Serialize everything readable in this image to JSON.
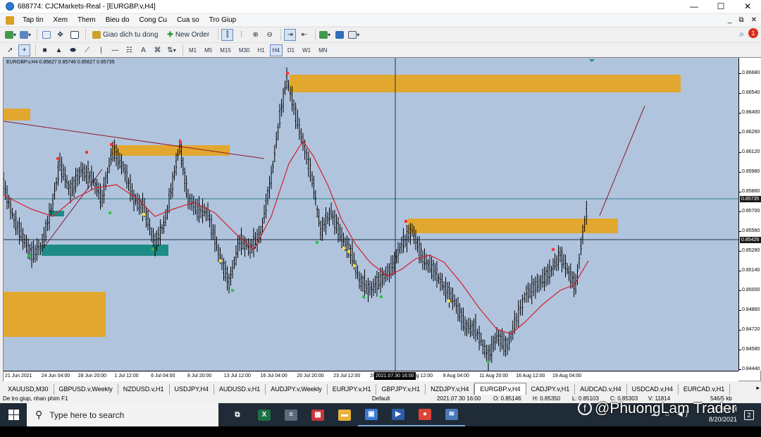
{
  "window": {
    "title": "688774: CJCMarkets-Real - [EURGBP.v,H4]",
    "controls": [
      "—",
      "☐",
      "✕"
    ]
  },
  "menu": {
    "items": [
      "Tap tin",
      "Xem",
      "Them",
      "Bieu do",
      "Cong Cu",
      "Cua so",
      "Tro Giup"
    ],
    "mdi_controls": [
      "_",
      "⧉",
      "✕"
    ]
  },
  "toolbar": {
    "autotrade_label": "Giao dich tu dong",
    "new_order_label": "New Order",
    "timeframes": [
      "M1",
      "M5",
      "M15",
      "M30",
      "H1",
      "H4",
      "D1",
      "W1",
      "MN"
    ],
    "active_timeframe": "H4",
    "notification_count": "1"
  },
  "chart": {
    "header": "EURGBP.v,H4  0.85627 0.85746 0.85627 0.85735",
    "price_labels": [
      "0.86680",
      "0.86540",
      "0.86400",
      "0.86260",
      "0.86120",
      "0.85980",
      "0.85860",
      "0.85700",
      "0.85560",
      "0.85280",
      "0.85140",
      "0.85000",
      "0.84860",
      "0.84720",
      "0.84580",
      "0.84440"
    ],
    "current_price": "0.85735",
    "crosshair_price": "0.85426",
    "time_labels": [
      "21 Jun 2021",
      "24 Jun 04:00",
      "28 Jun 20:00",
      "1 Jul 12:00",
      "6 Jul 04:00",
      "8 Jul 20:00",
      "13 Jul 12:00",
      "16 Jul 04:00",
      "20 Jul 20:00",
      "23 Jul 12:00",
      "28 Ju",
      "4 Aug 12:00",
      "9 Aug 04:00",
      "11 Aug 20:00",
      "16 Aug 12:00",
      "19 Aug 04:00"
    ],
    "crosshair_time": "2021.07.30 16:00",
    "colors": {
      "background": "#b1c4de",
      "candles": "#000000",
      "moving_average": "#d0202a",
      "supply_zone": "#e2a72e",
      "demand_zone": "#1e8c86"
    }
  },
  "tabs": {
    "items": [
      "XAUUSD,M30",
      "GBPUSD.v,Weekly",
      "NZDUSD.v,H1",
      "USDJPY,H4",
      "AUDUSD.v,H1",
      "AUDJPY.v,Weekly",
      "EURJPY.v,H1",
      "GBPJPY.v,H1",
      "NZDJPY.v,H4",
      "EURGBP.v,H4",
      "CADJPY.v,H1",
      "AUDCAD.v,H4",
      "USDCAD.v,H4",
      "EURCAD.v,H1"
    ],
    "active": "EURGBP.v,H4"
  },
  "status": {
    "help": "De tro giup, nhan phim F1",
    "profile": "Default",
    "datetime": "2021.07.30 16:00",
    "open": "O: 0.85146",
    "high": "H: 0.85350",
    "low": "L: 0.85103",
    "close": "C: 0.85303",
    "volume": "V: 11814",
    "traffic": "546/5 kb"
  },
  "taskbar": {
    "search_placeholder": "Type here to search",
    "time": "8:15 PM",
    "date": "8/20/2021",
    "notifications": "2",
    "apps": [
      {
        "name": "task-view",
        "color": "#1f2b36",
        "glyph": "⧉"
      },
      {
        "name": "excel",
        "color": "#1d7044",
        "glyph": "X"
      },
      {
        "name": "calculator",
        "color": "#5a6b7c",
        "glyph": "="
      },
      {
        "name": "app-grid",
        "color": "#c8363e",
        "glyph": "▦"
      },
      {
        "name": "file-explorer",
        "color": "#e8b33a",
        "glyph": "▬"
      },
      {
        "name": "store",
        "color": "#3a7bd5",
        "glyph": "▣"
      },
      {
        "name": "media",
        "color": "#2d5da8",
        "glyph": "▶"
      },
      {
        "name": "chrome",
        "color": "#db4437",
        "glyph": "●"
      },
      {
        "name": "metatrader",
        "color": "#4a78b8",
        "glyph": "≋"
      }
    ],
    "tray_glyphs": "^ ☁ ⌂ ◀)"
  },
  "watermark": {
    "text": "@PhuongLam Trader",
    "icon": "f"
  }
}
